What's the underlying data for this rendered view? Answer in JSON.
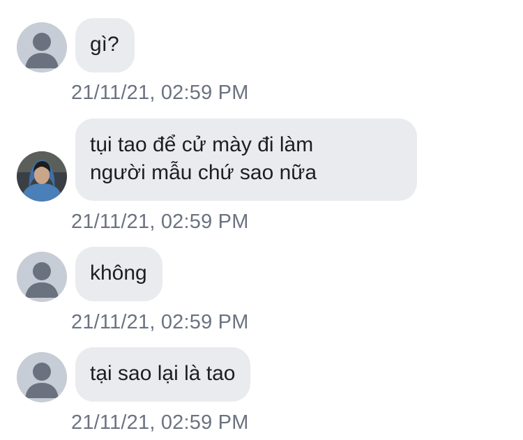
{
  "messages": [
    {
      "text": "gì?",
      "timestamp": "21/11/21, 02:59 PM",
      "avatar": "default-avatar-icon"
    },
    {
      "text": "tụi tao để cử mày đi làm\nngười mẫu chứ sao nữa",
      "timestamp": "21/11/21, 02:59 PM",
      "avatar": "profile-photo"
    },
    {
      "text": "không",
      "timestamp": "21/11/21, 02:59 PM",
      "avatar": "default-avatar-icon"
    },
    {
      "text": "tại sao lại là tao",
      "timestamp": "21/11/21, 02:59 PM",
      "avatar": "default-avatar-icon"
    }
  ],
  "colors": {
    "bubble": "#e9ebee",
    "text": "#1c1e21",
    "timestamp": "#6b7280",
    "avatar_bg": "#c7cdd6",
    "avatar_fg": "#6a7280"
  }
}
